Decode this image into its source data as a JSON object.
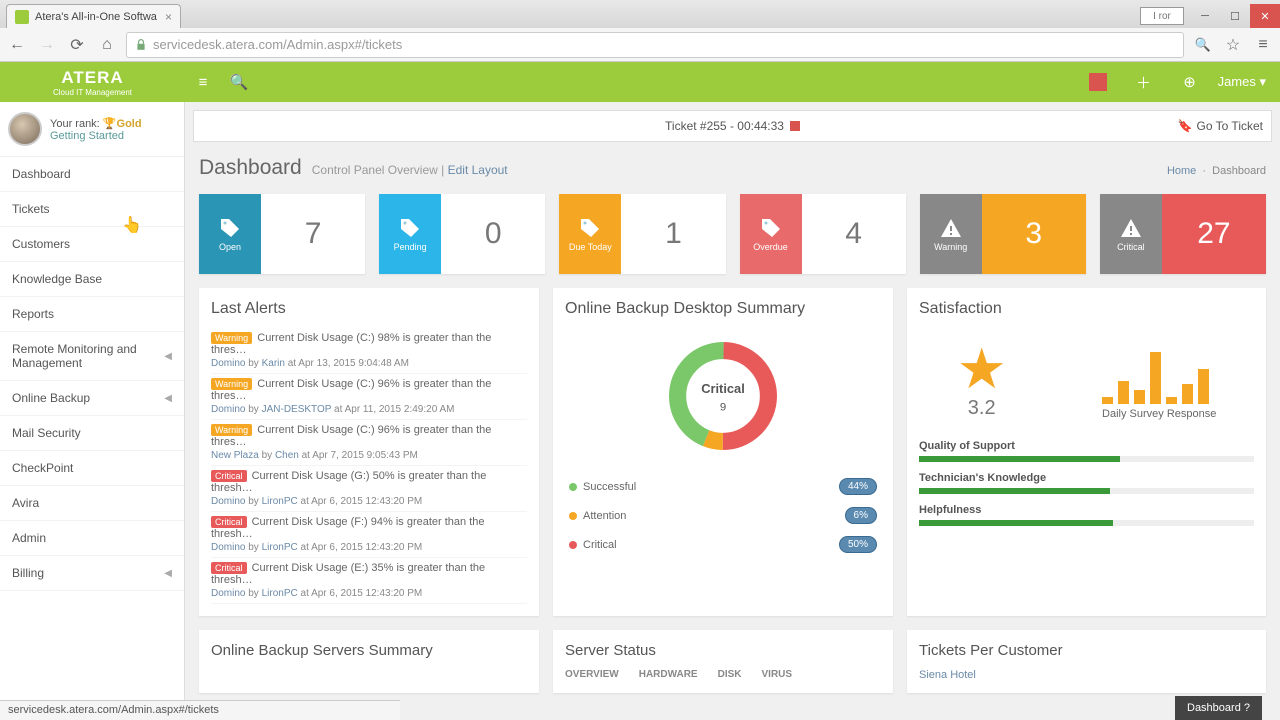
{
  "browser": {
    "tab_title": "Atera's All-in-One Softwa",
    "url_proto": "servicedesk.atera.com",
    "url_path": "/Admin.aspx#/tickets",
    "lang": "I ror"
  },
  "header": {
    "logo": "ATERA",
    "logo_sub": "Cloud IT Management",
    "user": "James"
  },
  "profile": {
    "rank_label": "Your rank:",
    "rank_value": "Gold",
    "getting_started": "Getting Started"
  },
  "sidebar": [
    {
      "label": "Dashboard",
      "expand": false
    },
    {
      "label": "Tickets",
      "expand": false
    },
    {
      "label": "Customers",
      "expand": false
    },
    {
      "label": "Knowledge Base",
      "expand": false
    },
    {
      "label": "Reports",
      "expand": false
    },
    {
      "label": "Remote Monitoring and Management",
      "expand": true
    },
    {
      "label": "Online Backup",
      "expand": true
    },
    {
      "label": "Mail Security",
      "expand": false
    },
    {
      "label": "CheckPoint",
      "expand": false
    },
    {
      "label": "Avira",
      "expand": false
    },
    {
      "label": "Admin",
      "expand": false
    },
    {
      "label": "Billing",
      "expand": true
    }
  ],
  "ticket_bar": {
    "text": "Ticket #255 - 00:44:33",
    "goto": "Go To Ticket"
  },
  "dash": {
    "title": "Dashboard",
    "sub1": "Control Panel Overview",
    "sub2": "Edit Layout",
    "crumb_home": "Home",
    "crumb_cur": "Dashboard"
  },
  "tiles": [
    {
      "label": "Open",
      "value": "7"
    },
    {
      "label": "Pending",
      "value": "0"
    },
    {
      "label": "Due Today",
      "value": "1"
    },
    {
      "label": "Overdue",
      "value": "4"
    },
    {
      "label": "Warning",
      "value": "3"
    },
    {
      "label": "Critical",
      "value": "27"
    }
  ],
  "alerts_title": "Last Alerts",
  "alerts": [
    {
      "sev": "Warning",
      "msg": "Current Disk Usage (C:) 98% is greater than the thres…",
      "cust": "Domino",
      "by": "Karin",
      "at": "Apr 13, 2015 9:04:48 AM"
    },
    {
      "sev": "Warning",
      "msg": "Current Disk Usage (C:) 96% is greater than the thres…",
      "cust": "Domino",
      "by": "JAN-DESKTOP",
      "at": "Apr 11, 2015 2:49:20 AM"
    },
    {
      "sev": "Warning",
      "msg": "Current Disk Usage (C:) 96% is greater than the thres…",
      "cust": "New Plaza",
      "by": "Chen",
      "at": "Apr 7, 2015 9:05:43 PM"
    },
    {
      "sev": "Critical",
      "msg": "Current Disk Usage (G:) 50% is greater than the thresh…",
      "cust": "Domino",
      "by": "LironPC",
      "at": "Apr 6, 2015 12:43:20 PM"
    },
    {
      "sev": "Critical",
      "msg": "Current Disk Usage (F:) 94% is greater than the thresh…",
      "cust": "Domino",
      "by": "LironPC",
      "at": "Apr 6, 2015 12:43:20 PM"
    },
    {
      "sev": "Critical",
      "msg": "Current Disk Usage (E:) 35% is greater than the thresh…",
      "cust": "Domino",
      "by": "LironPC",
      "at": "Apr 6, 2015 12:43:20 PM"
    }
  ],
  "backup": {
    "title": "Online Backup Desktop Summary",
    "center_top": "Critical",
    "center_num": "9",
    "rows": [
      {
        "label": "Successful",
        "pct": "44%",
        "cls": "g"
      },
      {
        "label": "Attention",
        "pct": "6%",
        "cls": "y"
      },
      {
        "label": "Critical",
        "pct": "50%",
        "cls": "r"
      }
    ]
  },
  "sat": {
    "title": "Satisfaction",
    "score": "3.2",
    "bars_label": "Daily Survey Response",
    "metrics": [
      {
        "label": "Quality of Support",
        "pct": 60
      },
      {
        "label": "Technician's Knowledge",
        "pct": 57
      },
      {
        "label": "Helpfulness",
        "pct": 58
      }
    ]
  },
  "bottom": {
    "p1": "Online Backup Servers Summary",
    "p2": "Server Status",
    "p3": "Tickets Per Customer",
    "tabs": [
      "OVERVIEW",
      "HARDWARE",
      "DISK",
      "VIRUS"
    ],
    "first_cust": "Siena Hotel"
  },
  "help_btn": "Dashboard ?",
  "status_url": "servicedesk.atera.com/Admin.aspx#/tickets",
  "chart_data": {
    "donut": {
      "type": "pie",
      "title": "Online Backup Desktop Summary",
      "series": [
        {
          "name": "Successful",
          "value": 44
        },
        {
          "name": "Attention",
          "value": 6
        },
        {
          "name": "Critical",
          "value": 50
        }
      ],
      "center_label": "Critical",
      "center_value": 9
    },
    "survey_bars": {
      "type": "bar",
      "title": "Daily Survey Response",
      "values": [
        10,
        32,
        20,
        72,
        10,
        28,
        48
      ]
    }
  }
}
